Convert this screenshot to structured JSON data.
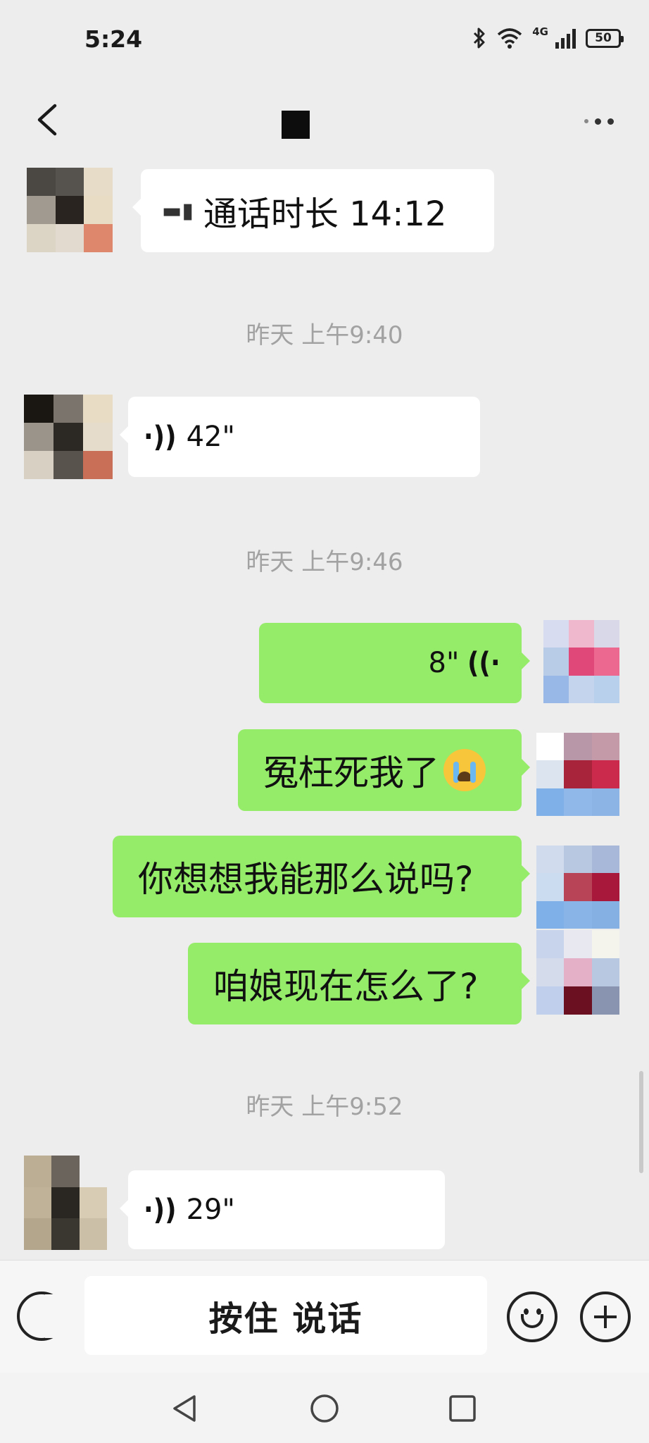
{
  "status_bar": {
    "time": "5:24",
    "network": "4G",
    "battery": "50"
  },
  "header": {
    "more_icon": "more-dots-icon",
    "back_icon": "chevron-left-icon"
  },
  "messages": [
    {
      "type": "call",
      "direction": "in",
      "text": "通话时长 14:12"
    },
    {
      "type": "time",
      "text": "昨天 上午9:40"
    },
    {
      "type": "voice",
      "direction": "in",
      "duration": "42\""
    },
    {
      "type": "time",
      "text": "昨天 上午9:46"
    },
    {
      "type": "voice",
      "direction": "out",
      "duration": "8\""
    },
    {
      "type": "text",
      "direction": "out",
      "text": "冤枉死我了"
    },
    {
      "type": "text",
      "direction": "out",
      "text": "你想想我能那么说吗?"
    },
    {
      "type": "text",
      "direction": "out",
      "text": "咱娘现在怎么了?"
    },
    {
      "type": "time",
      "text": "昨天 上午9:52"
    },
    {
      "type": "voice",
      "direction": "in",
      "duration": "29\""
    }
  ],
  "input_bar": {
    "hold_to_talk": "按住 说话"
  },
  "colors": {
    "background": "#ededed",
    "incoming_bubble": "#ffffff",
    "outgoing_bubble": "#95ec69",
    "timestamp": "#a2a2a2"
  }
}
